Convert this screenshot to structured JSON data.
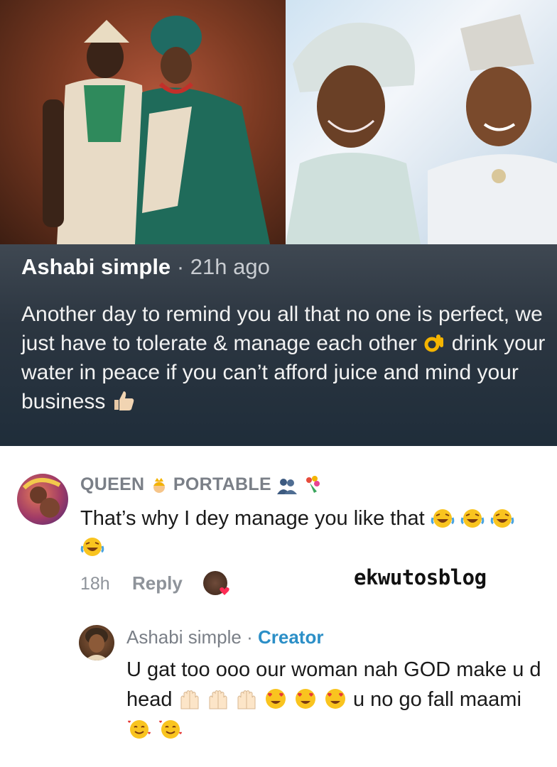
{
  "post": {
    "author": "Ashabi simple",
    "separator": "·",
    "time": "21h ago",
    "text_before_ok": "Another day to remind you all that no one is perfect, we just have to tolerate & manage each other ",
    "text_after_ok": " drink your water in peace if you can’t afford juice and mind your business ",
    "icons": [
      "ok-hand-emoji",
      "thumbs-up-emoji"
    ]
  },
  "comment": {
    "username_part1": "QUEEN",
    "username_part2": "PORTABLE",
    "text": "That’s why I dey manage you like that ",
    "time": "18h",
    "reply_label": "Reply",
    "icons": [
      "princess-emoji",
      "couple-silhouette-emoji",
      "bouquet-emoji",
      "laughing-emoji"
    ]
  },
  "watermark": "ekwutosblog",
  "reply": {
    "author": "Ashabi simple",
    "separator": " · ",
    "badge": "Creator",
    "text_part1": "U gat too ooo our woman nah GOD make u d head ",
    "text_part2": " u no go fall maami ",
    "icons": [
      "raising-hands-emoji",
      "heart-eyes-emoji",
      "smiling-face-with-hearts-emoji"
    ]
  }
}
